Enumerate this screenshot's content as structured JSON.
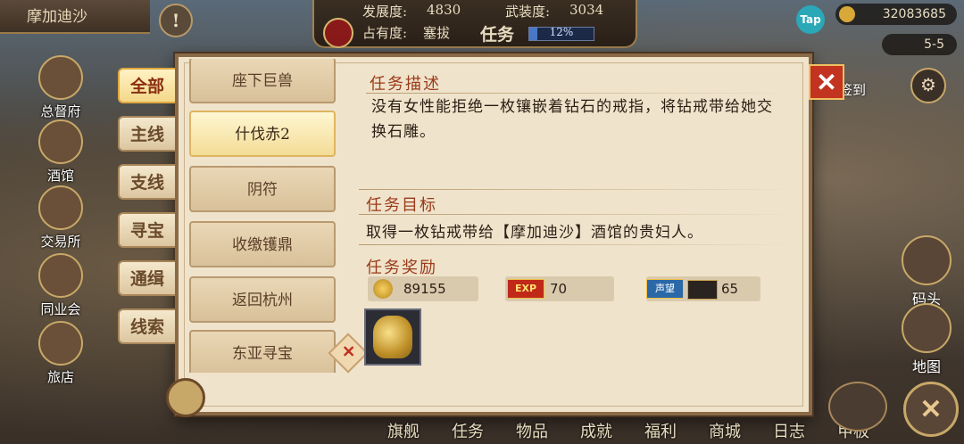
{
  "location": "摩加迪沙",
  "stats": {
    "development_label": "发展度:",
    "development_value": "4830",
    "armament_label": "武装度:",
    "armament_value": "3034",
    "occupancy_label": "占有度:",
    "occupancy_value": "塞拔",
    "task_label": "任务",
    "task_progress_percent": 12,
    "task_progress_text": "12%"
  },
  "top_right": {
    "tap_label": "Tap",
    "coins": "32083685",
    "level": "5-5",
    "signin": "签到"
  },
  "left_menu": [
    {
      "label": "总督府",
      "icon": "governor-icon"
    },
    {
      "label": "酒馆",
      "icon": "tavern-icon"
    },
    {
      "label": "交易所",
      "icon": "exchange-icon"
    },
    {
      "label": "同业会",
      "icon": "guild-icon"
    },
    {
      "label": "旅店",
      "icon": "inn-icon"
    }
  ],
  "right_menu": [
    {
      "label": "码头",
      "icon": "dock-icon"
    },
    {
      "label": "地图",
      "icon": "map-icon"
    }
  ],
  "tabs": [
    {
      "label": "全部",
      "active": true
    },
    {
      "label": "主线",
      "active": false
    },
    {
      "label": "支线",
      "active": false
    },
    {
      "label": "寻宝",
      "active": false
    },
    {
      "label": "通缉",
      "active": false
    },
    {
      "label": "线索",
      "active": false
    }
  ],
  "quests": [
    {
      "label": "座下巨兽",
      "active": false
    },
    {
      "label": "什伐赤2",
      "active": true
    },
    {
      "label": "阴符",
      "active": false
    },
    {
      "label": "收缴镬鼎",
      "active": false
    },
    {
      "label": "返回杭州",
      "active": false
    },
    {
      "label": "东亚寻宝",
      "active": false
    }
  ],
  "detail": {
    "desc_title": "任务描述",
    "desc_text": "没有女性能拒绝一枚镶嵌着钻石的戒指，将钻戒带给她交换石雕。",
    "goal_title": "任务目标",
    "goal_text": "取得一枚钻戒带给【摩加迪沙】酒馆的贵妇人。",
    "reward_title": "任务奖励",
    "rewards": {
      "gold": "89155",
      "exp_icon": "EXP",
      "exp": "70",
      "reputation_icon": "声望",
      "reputation": "65"
    },
    "reward_item_icon": "golden-lion-statue-icon"
  },
  "bottom_nav": [
    "旗舰",
    "任务",
    "物品",
    "成就",
    "福利",
    "商城",
    "日志",
    "甲板"
  ],
  "colors": {
    "accent_red": "#9a3a1a",
    "panel": "#efe3cb",
    "close_button": "#c23420"
  }
}
